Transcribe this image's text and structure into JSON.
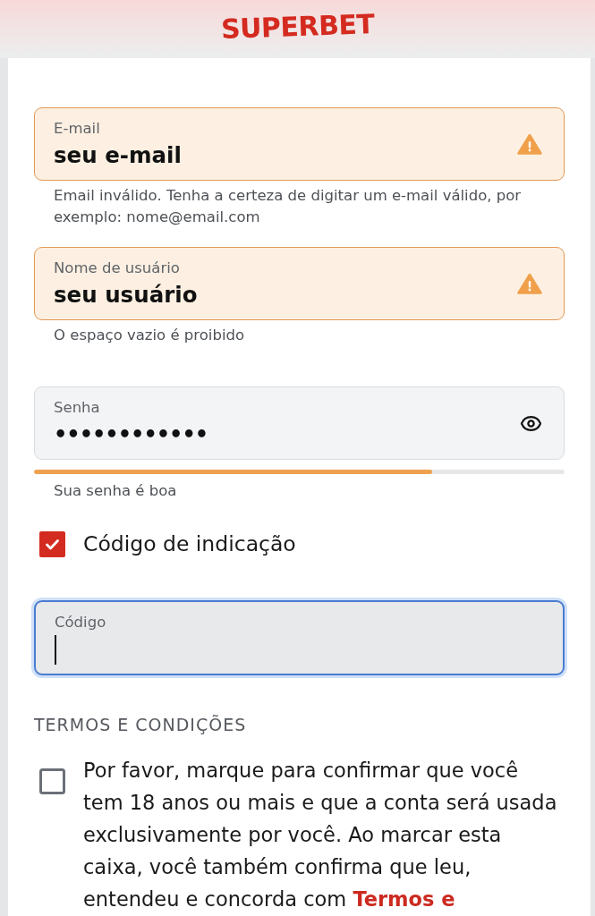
{
  "header": {
    "logo": "SUPERBET"
  },
  "fields": [
    {
      "kind": "text",
      "label": "E-mail",
      "value": "seu e-mail",
      "invalid": true,
      "helper": "Email inválido. Tenha a certeza de digitar um e-mail válido, por exemplo: nome@email.com"
    },
    {
      "kind": "text",
      "label": "Nome de usuário",
      "value": "seu usuário",
      "invalid": true,
      "helper": "O espaço vazio é proibido"
    },
    {
      "kind": "password",
      "label": "Senha",
      "value": "••••••••••••",
      "invalid": false,
      "strength": {
        "level": 0.75,
        "text": "Sua senha é boa"
      }
    }
  ],
  "referral": {
    "checked": true,
    "label": "Código de indicação",
    "code_field": {
      "label": "Código",
      "focused": true
    }
  },
  "terms": {
    "heading": "TERMOS E CONDIÇÕES",
    "checked": false,
    "text": "Por favor, marque para confirmar que você tem 18 anos ou mais e que a conta será usada exclusivamente por você. Ao marcar esta caixa, você também confirma que leu, entendeu e concorda com",
    "link": "Termos e"
  }
}
